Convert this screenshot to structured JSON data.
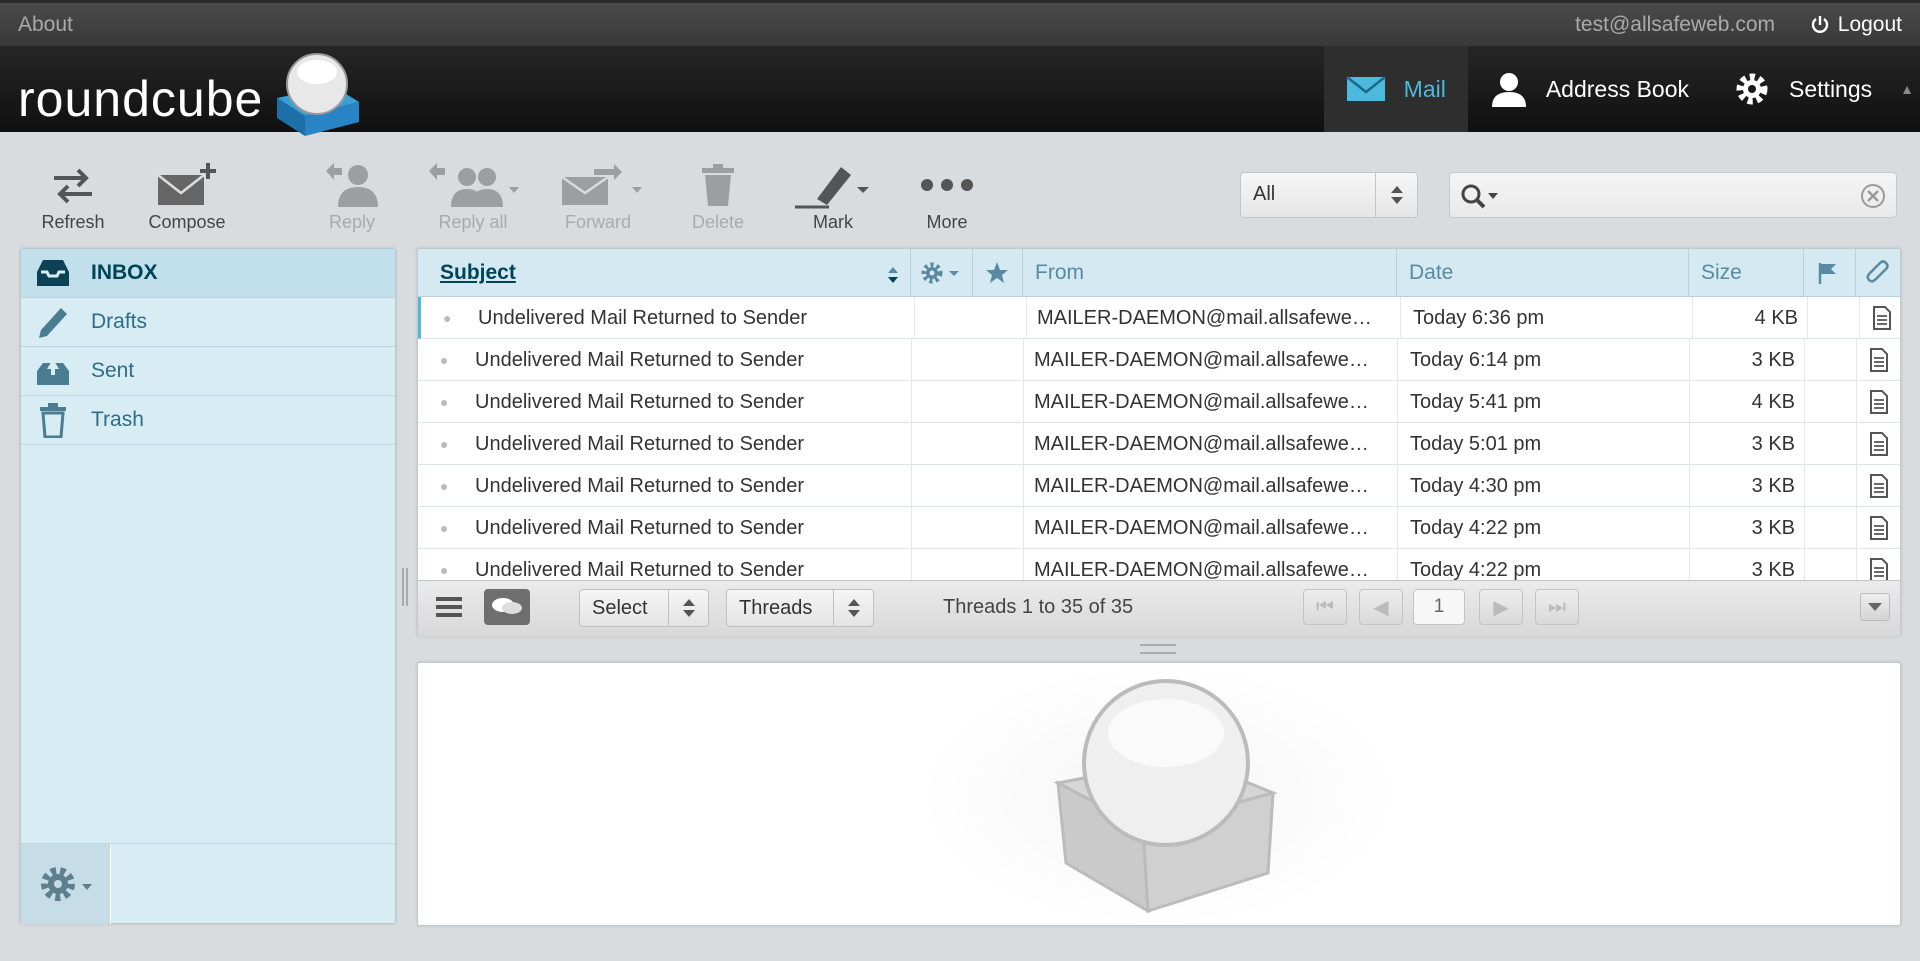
{
  "topline": {
    "about": "About",
    "user": "test@allsafeweb.com",
    "logout": "Logout"
  },
  "logo": {
    "text": "roundcube"
  },
  "taskbar": [
    {
      "label": "Mail",
      "icon": "mail-icon",
      "selected": true
    },
    {
      "label": "Address Book",
      "icon": "person-icon",
      "selected": false
    },
    {
      "label": "Settings",
      "icon": "gear-icon",
      "selected": false
    }
  ],
  "toolbar": {
    "refresh": "Refresh",
    "compose": "Compose",
    "reply": "Reply",
    "reply_all": "Reply all",
    "forward": "Forward",
    "delete": "Delete",
    "mark": "Mark",
    "more": "More"
  },
  "filter": {
    "value": "All"
  },
  "search": {
    "placeholder": ""
  },
  "folders": [
    {
      "label": "INBOX",
      "icon": "inbox-icon",
      "selected": true
    },
    {
      "label": "Drafts",
      "icon": "pencil-icon",
      "selected": false
    },
    {
      "label": "Sent",
      "icon": "sent-icon",
      "selected": false
    },
    {
      "label": "Trash",
      "icon": "trash-icon",
      "selected": false
    }
  ],
  "list_header": {
    "subject": "Subject",
    "from": "From",
    "date": "Date",
    "size": "Size"
  },
  "messages": [
    {
      "subject": "Undelivered Mail Returned to Sender",
      "from": "MAILER-DAEMON@mail.allsafewe…",
      "date": "Today 6:36 pm",
      "size": "4 KB"
    },
    {
      "subject": "Undelivered Mail Returned to Sender",
      "from": "MAILER-DAEMON@mail.allsafewe…",
      "date": "Today 6:14 pm",
      "size": "3 KB"
    },
    {
      "subject": "Undelivered Mail Returned to Sender",
      "from": "MAILER-DAEMON@mail.allsafewe…",
      "date": "Today 5:41 pm",
      "size": "4 KB"
    },
    {
      "subject": "Undelivered Mail Returned to Sender",
      "from": "MAILER-DAEMON@mail.allsafewe…",
      "date": "Today 5:01 pm",
      "size": "3 KB"
    },
    {
      "subject": "Undelivered Mail Returned to Sender",
      "from": "MAILER-DAEMON@mail.allsafewe…",
      "date": "Today 4:30 pm",
      "size": "3 KB"
    },
    {
      "subject": "Undelivered Mail Returned to Sender",
      "from": "MAILER-DAEMON@mail.allsafewe…",
      "date": "Today 4:22 pm",
      "size": "3 KB"
    },
    {
      "subject": "Undelivered Mail Returned to Sender",
      "from": "MAILER-DAEMON@mail.allsafewe…",
      "date": "Today 4:22 pm",
      "size": "3 KB"
    }
  ],
  "list_footer": {
    "select": "Select",
    "threads": "Threads",
    "count": "Threads 1 to 35 of 35",
    "page": "1"
  },
  "colors": {
    "accent": "#4cb9dd",
    "folder_bg": "#d8ecf4",
    "header_bg": "#1a1a1a"
  }
}
